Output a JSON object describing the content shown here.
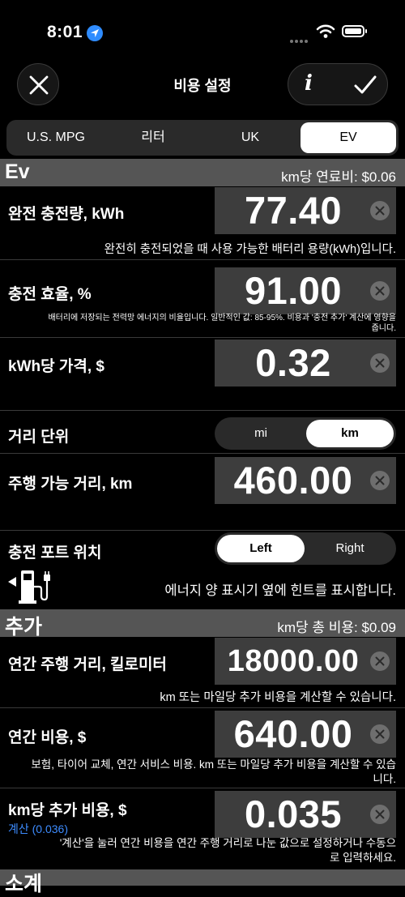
{
  "status": {
    "time": "8:01"
  },
  "nav": {
    "title": "비용 설정"
  },
  "tabs": [
    {
      "label": "U.S. MPG",
      "active": false
    },
    {
      "label": "리터",
      "active": false
    },
    {
      "label": "UK",
      "active": false
    },
    {
      "label": "EV",
      "active": true
    }
  ],
  "ev_section": {
    "title": "Ev",
    "info": "km당 연료비: $0.06"
  },
  "battery": {
    "label": "완전 충전량, kWh",
    "value": "77.40",
    "desc": "완전히 충전되었을 때 사용 가능한 배터리 용량(kWh)입니다."
  },
  "efficiency": {
    "label": "충전 효율, %",
    "value": "91.00",
    "desc": "배터리에 저장되는 전력망 에너지의 비율입니다. 일반적인 값: 85-95%. 비용과 '충전 추가' 계산에 영향을 줍니다."
  },
  "price": {
    "label": "kWh당 가격, $",
    "value": "0.32"
  },
  "distance_unit": {
    "label": "거리 단위",
    "options": [
      "mi",
      "km"
    ],
    "selected": "km"
  },
  "range": {
    "label": "주행 가능 거리, km",
    "value": "460.00"
  },
  "port": {
    "label": "충전 포트 위치",
    "options": [
      "Left",
      "Right"
    ],
    "selected": "Left",
    "desc": "에너지 양 표시기 옆에 힌트를 표시합니다."
  },
  "extra_section": {
    "title": "추가",
    "info": "km당 총 비용: $0.09"
  },
  "annual_distance": {
    "label": "연간 주행 거리, 킬로미터",
    "value": "18000.00",
    "desc": "km 또는 마일당 추가 비용을 계산할 수 있습니다."
  },
  "annual_cost": {
    "label": "연간 비용, $",
    "value": "640.00",
    "desc": "보험, 타이어 교체, 연간 서비스 비용. km 또는 마일당 추가 비용을 계산할 수 있습니다."
  },
  "per_km": {
    "label": "km당 추가 비용, $",
    "value": "0.035",
    "calc_link": "계산 (0.036)",
    "desc": "'계산'을 눌러 연간 비용을 연간 주행 거리로 나눈 값으로 설정하거나 수동으로 입력하세요."
  },
  "next_section": {
    "title": "소계"
  },
  "colors": {
    "accent": "#3d8cff",
    "section": "#555555",
    "field": "#3d3d3d"
  }
}
